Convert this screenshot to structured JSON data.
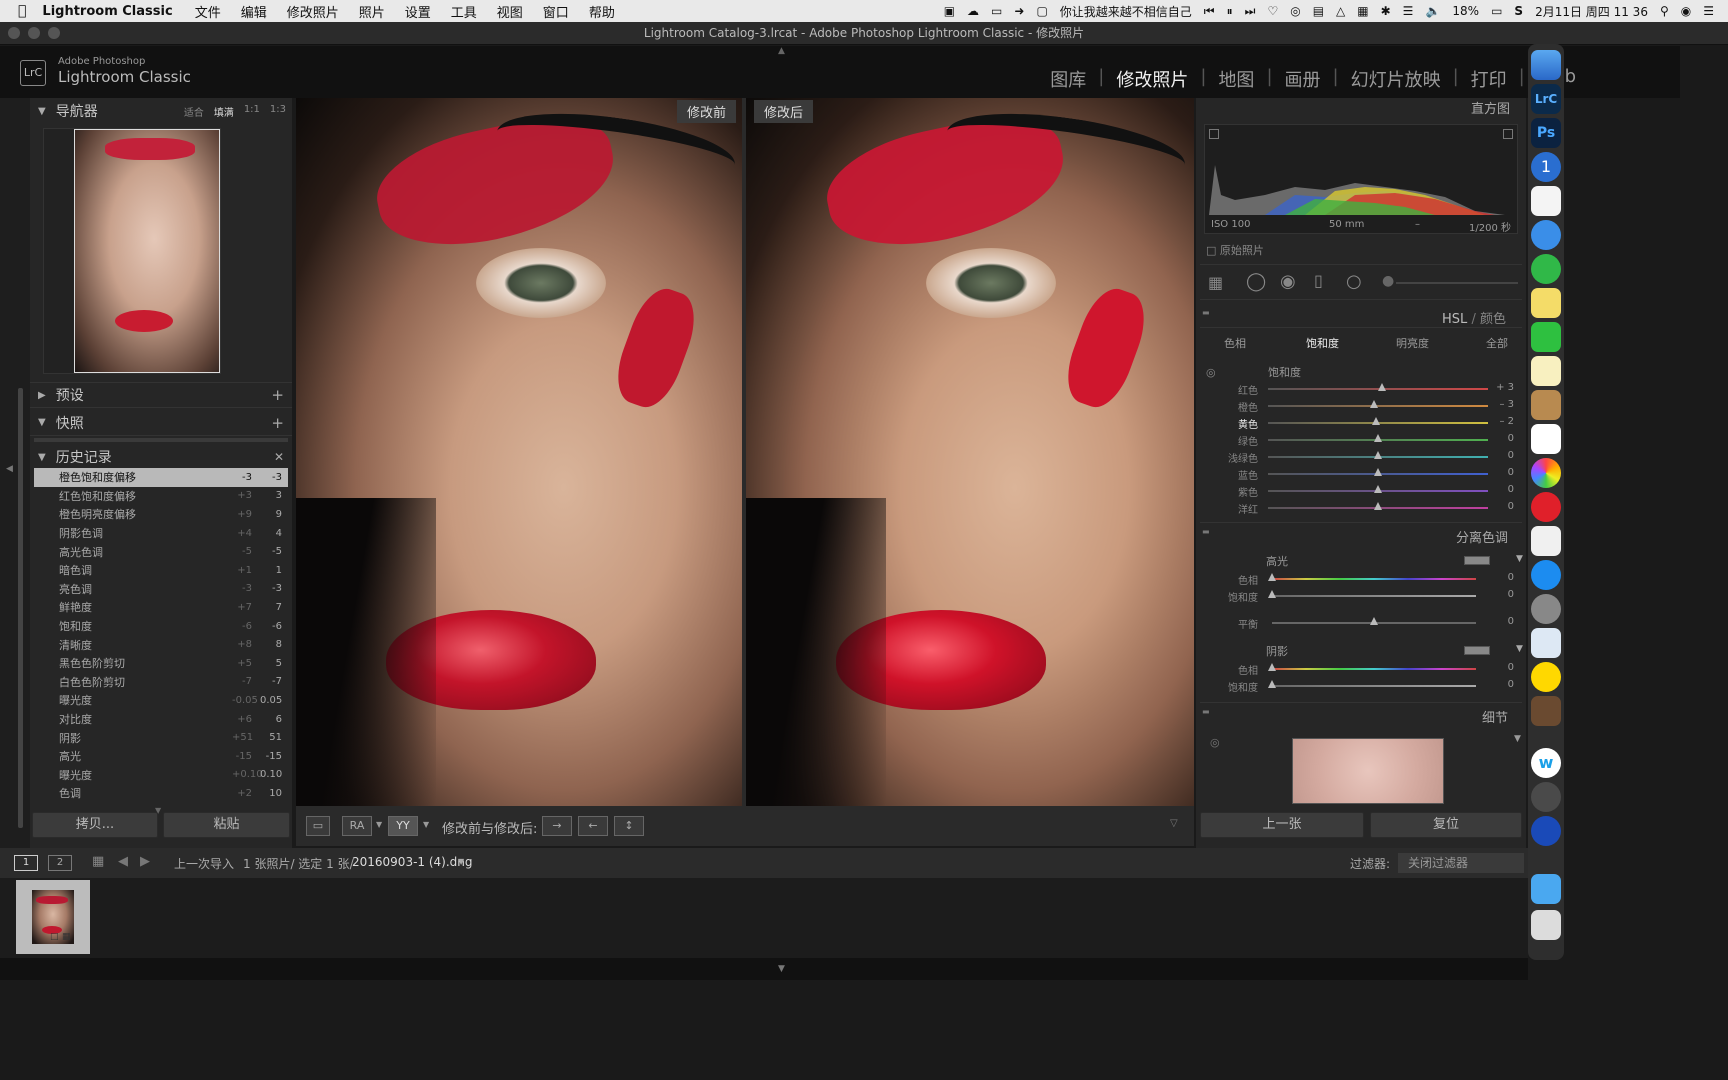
{
  "menubar": {
    "app_name": "Lightroom Classic",
    "items": [
      "文件",
      "编辑",
      "修改照片",
      "照片",
      "设置",
      "工具",
      "视图",
      "窗口",
      "帮助"
    ],
    "now_playing": "你让我越来越不相信自己",
    "battery": "18%",
    "datetime": "2月11日 周四 11 36"
  },
  "window": {
    "title": "Lightroom Catalog-3.lrcat - Adobe Photoshop Lightroom Classic - 修改照片"
  },
  "header": {
    "logo": "LrC",
    "brand_line1": "Adobe Photoshop",
    "brand_line2": "Lightroom Classic",
    "modules": [
      {
        "label": "图库",
        "active": false
      },
      {
        "label": "修改照片",
        "active": true
      },
      {
        "label": "地图",
        "active": false
      },
      {
        "label": "画册",
        "active": false
      },
      {
        "label": "幻灯片放映",
        "active": false
      },
      {
        "label": "打印",
        "active": false
      },
      {
        "label": "Web",
        "active": false
      }
    ]
  },
  "left": {
    "navigator": {
      "title": "导航器",
      "zoom": [
        "适合",
        "填满",
        "1:1",
        "1:3"
      ]
    },
    "presets_title": "预设",
    "snapshots_title": "快照",
    "history_title": "历史记录",
    "history": [
      {
        "name": "橙色饱和度偏移",
        "delta": "-3",
        "value": "-3",
        "selected": true
      },
      {
        "name": "红色饱和度偏移",
        "delta": "+3",
        "value": "3"
      },
      {
        "name": "橙色明亮度偏移",
        "delta": "+9",
        "value": "9"
      },
      {
        "name": "阴影色调",
        "delta": "+4",
        "value": "4"
      },
      {
        "name": "高光色调",
        "delta": "-5",
        "value": "-5"
      },
      {
        "name": "暗色调",
        "delta": "+1",
        "value": "1"
      },
      {
        "name": "亮色调",
        "delta": "-3",
        "value": "-3"
      },
      {
        "name": "鲜艳度",
        "delta": "+7",
        "value": "7"
      },
      {
        "name": "饱和度",
        "delta": "-6",
        "value": "-6"
      },
      {
        "name": "清晰度",
        "delta": "+8",
        "value": "8"
      },
      {
        "name": "黑色色阶剪切",
        "delta": "+5",
        "value": "5"
      },
      {
        "name": "白色色阶剪切",
        "delta": "-7",
        "value": "-7"
      },
      {
        "name": "曝光度",
        "delta": "-0.05",
        "value": "0.05"
      },
      {
        "name": "对比度",
        "delta": "+6",
        "value": "6"
      },
      {
        "name": "阴影",
        "delta": "+51",
        "value": "51"
      },
      {
        "name": "高光",
        "delta": "-15",
        "value": "-15"
      },
      {
        "name": "曝光度",
        "delta": "+0.10",
        "value": "0.10"
      },
      {
        "name": "色调",
        "delta": "+2",
        "value": "10"
      }
    ],
    "copy_button": "拷贝...",
    "paste_button": "粘贴"
  },
  "photo": {
    "before_label": "修改前",
    "after_label": "修改后"
  },
  "toolbar": {
    "view_labels": [
      "RA",
      "YY"
    ],
    "compare_label": "修改前与修改后:"
  },
  "right": {
    "histogram": {
      "title": "直方图",
      "iso": "ISO 100",
      "focal": "50 mm",
      "aperture": "–",
      "shutter": "1/200 秒",
      "original_label": "原始照片"
    },
    "hsl": {
      "title_main": "HSL",
      "title_sub": "颜色",
      "tabs": [
        "色相",
        "饱和度",
        "明亮度",
        "全部"
      ],
      "active_tab": "饱和度",
      "section": "饱和度",
      "sliders": [
        {
          "label": "红色",
          "value": "+ 3",
          "level": 0.52,
          "color": "#d04848"
        },
        {
          "label": "橙色",
          "value": "– 3",
          "level": 0.48,
          "color": "#d08a40"
        },
        {
          "label": "黄色",
          "value": "– 2",
          "level": 0.49,
          "color": "#d0c040",
          "active": true
        },
        {
          "label": "绿色",
          "value": "0",
          "level": 0.5,
          "color": "#50b050"
        },
        {
          "label": "浅绿色",
          "value": "0",
          "level": 0.5,
          "color": "#40b0b0"
        },
        {
          "label": "蓝色",
          "value": "0",
          "level": 0.5,
          "color": "#4060d0"
        },
        {
          "label": "紫色",
          "value": "0",
          "level": 0.5,
          "color": "#8050c0"
        },
        {
          "label": "洋红",
          "value": "0",
          "level": 0.5,
          "color": "#c040a0"
        }
      ]
    },
    "split_toning": {
      "title": "分离色调",
      "highlights": "高光",
      "hue": "色相",
      "saturation": "饱和度",
      "balance": "平衡",
      "shadows": "阴影",
      "values": {
        "h_hue": "0",
        "h_sat": "0",
        "balance": "0",
        "s_hue": "0",
        "s_sat": "0"
      }
    },
    "detail_title": "细节",
    "prev_button": "上一张",
    "reset_button": "复位"
  },
  "filmstrip": {
    "page1": "1",
    "page2": "2",
    "source": "上一次导入",
    "count_text": "1 张照片/ 选定 1 张/",
    "filename": "20160903-1 (4).dng",
    "filter_label": "过滤器:",
    "filter_value": "关闭过滤器"
  }
}
